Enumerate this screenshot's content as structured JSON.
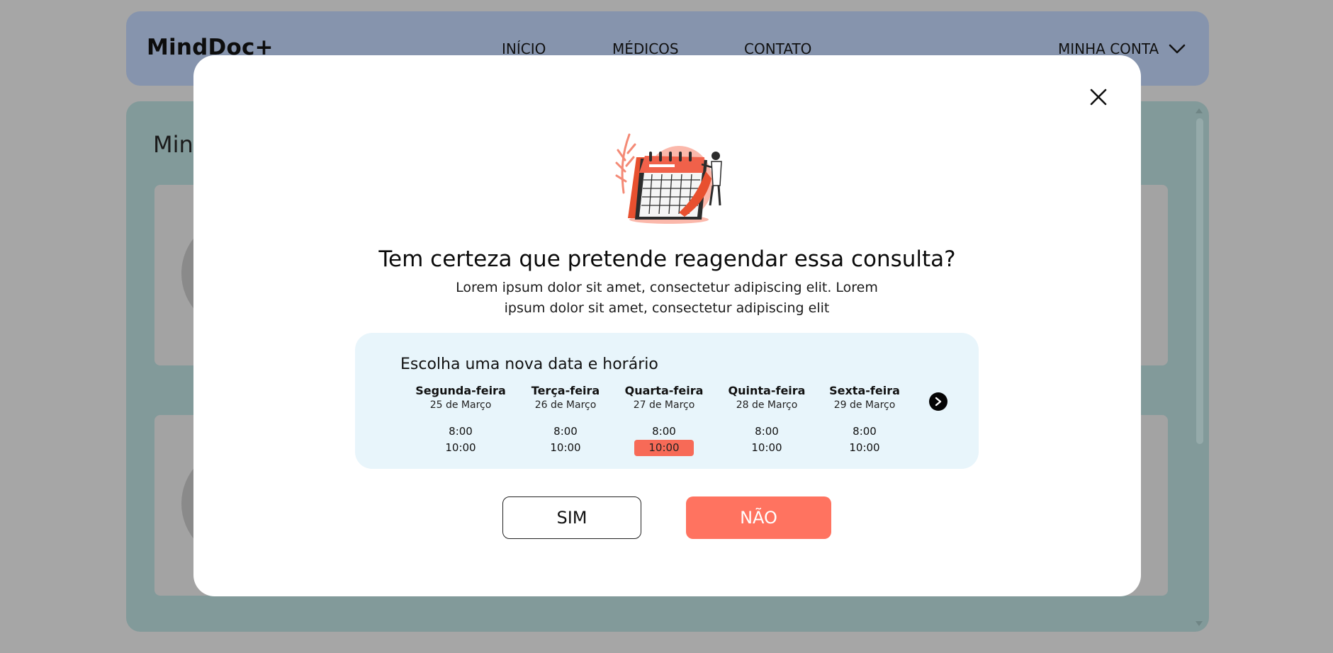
{
  "navbar": {
    "brand": "MindDoc+",
    "links": [
      "INÍCIO",
      "MÉDICOS",
      "CONTATO"
    ],
    "account_label": "MINHA CONTA",
    "account_icon": "chevron-down-icon"
  },
  "background": {
    "title": "Min"
  },
  "modal": {
    "close_icon": "close-icon",
    "illustration": "calendar-illustration",
    "title": "Tem certeza que pretende reagendar essa consulta?",
    "description": "Lorem ipsum dolor sit amet, consectetur adipiscing elit. Lorem ipsum dolor sit amet, consectetur adipiscing elit",
    "schedule": {
      "title": "Escolha uma nova data e horário",
      "days": [
        {
          "name": "Segunda-feira",
          "date": "25 de Março",
          "slots": [
            "8:00",
            "10:00"
          ]
        },
        {
          "name": "Terça-feira",
          "date": "26 de Março",
          "slots": [
            "8:00",
            "10:00"
          ]
        },
        {
          "name": "Quarta-feira",
          "date": "27 de Março",
          "slots": [
            "8:00",
            "10:00"
          ]
        },
        {
          "name": "Quinta-feira",
          "date": "28 de Março",
          "slots": [
            "8:00",
            "10:00"
          ]
        },
        {
          "name": "Sexta-feira",
          "date": "29 de Março",
          "slots": [
            "8:00",
            "10:00"
          ]
        }
      ],
      "selected": {
        "day": "Quarta-feira",
        "time": "10:00"
      },
      "next_icon": "chevron-right-icon"
    },
    "buttons": {
      "yes": "SIM",
      "no": "NÃO"
    },
    "colors": {
      "accent": "#ff7360",
      "selected_slot": "#f76a57",
      "schedule_bg": "#e8f5fb"
    }
  }
}
